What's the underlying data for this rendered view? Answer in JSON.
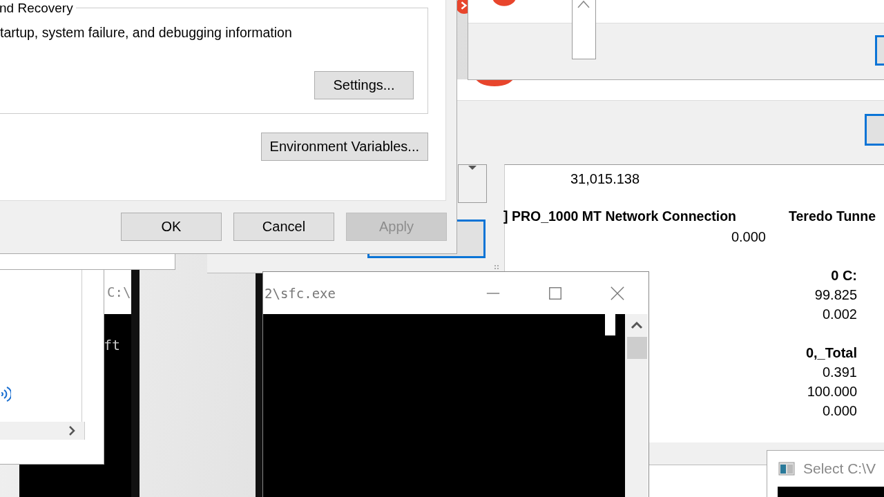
{
  "system_properties": {
    "group_title": "nd Recovery",
    "group_text": "tartup, system failure, and debugging information",
    "settings_button": "Settings...",
    "environment_button": "Environment Variables...",
    "footer_buttons": [
      {
        "label": "OK",
        "disabled": false
      },
      {
        "label": "Cancel",
        "disabled": false
      },
      {
        "label": "Apply",
        "disabled": true
      }
    ]
  },
  "console_left": {
    "title": "C:\\",
    "text": "ft"
  },
  "sfc_console": {
    "title": "2\\sfc.exe"
  },
  "perf_report": {
    "top_value": "31,015.138",
    "network_header": "] PRO_1000 MT Network Connection",
    "network_value": "0.000",
    "teredo_header": "Teredo Tunne",
    "disk_header": "0 C:",
    "disk_values": [
      "99.825",
      "0.002"
    ],
    "total_header": "0,_Total",
    "total_values": [
      "0.391",
      "100.000",
      "0.000"
    ]
  },
  "select_window": {
    "title": "Select C:\\V"
  }
}
